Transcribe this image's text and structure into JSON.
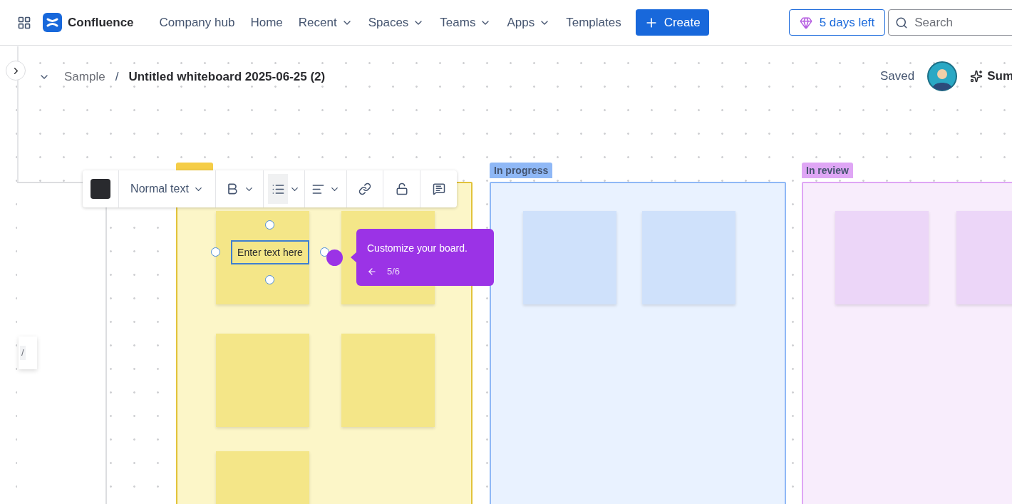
{
  "header": {
    "product": "Confluence",
    "nav": [
      {
        "label": "Company hub",
        "dropdown": false
      },
      {
        "label": "Home",
        "dropdown": false
      },
      {
        "label": "Recent",
        "dropdown": true
      },
      {
        "label": "Spaces",
        "dropdown": true
      },
      {
        "label": "Teams",
        "dropdown": true
      },
      {
        "label": "Apps",
        "dropdown": true
      },
      {
        "label": "Templates",
        "dropdown": false
      }
    ],
    "create": "Create",
    "trial": "5 days left",
    "search": {
      "placeholder": "Search"
    }
  },
  "breadcrumb": {
    "space": "Sample",
    "separator": "/",
    "title": "Untitled whiteboard 2025-06-25 (2)"
  },
  "page_actions": {
    "status": "Saved",
    "summarize": "Sum"
  },
  "shortcut_hint": "/",
  "toolbar": {
    "text_style": "Normal text",
    "list_selected": true
  },
  "columns": [
    {
      "color": "#f5cd47"
    },
    {
      "label": "In progress",
      "color": "#8fb8f6"
    },
    {
      "label": "In review",
      "color": "#dfa6f5"
    }
  ],
  "sticky_editor": {
    "placeholder": "Enter text here"
  },
  "tour": {
    "text": "Customize your board.",
    "step": "5/6"
  }
}
